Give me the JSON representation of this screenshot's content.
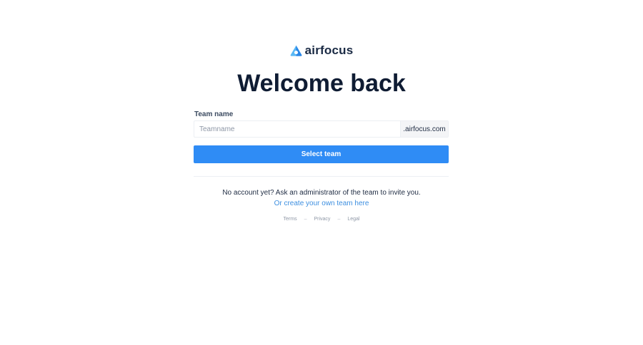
{
  "brand": {
    "name": "airfocus",
    "logo_icon": "airfocus-logo-icon",
    "colors": {
      "logo_light": "#5ab8f5",
      "logo_dark": "#2a86e6"
    }
  },
  "heading": "Welcome back",
  "form": {
    "team_label": "Team name",
    "team_placeholder": "Teamname",
    "team_value": "",
    "domain_suffix": ".airfocus.com",
    "submit_label": "Select team",
    "submit_color": "#2f8cf5"
  },
  "signup": {
    "message": "No account yet? Ask an administrator of the team to invite you.",
    "create_link": "Or create your own team here",
    "link_color": "#3d8fe0"
  },
  "footer": {
    "links": [
      "Terms",
      "Privacy",
      "Legal"
    ],
    "separator": "–"
  }
}
